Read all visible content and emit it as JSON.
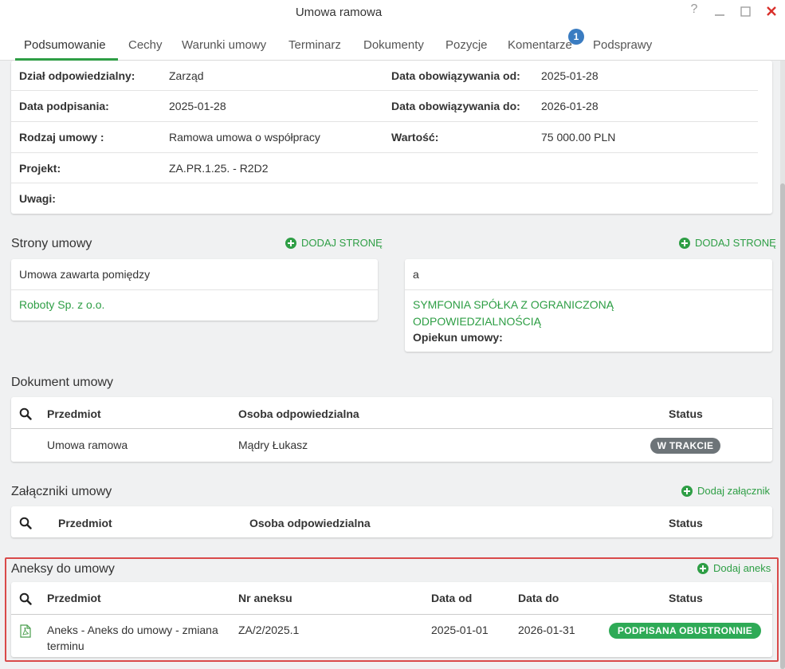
{
  "window": {
    "title": "Umowa ramowa"
  },
  "tabs": [
    {
      "label": "Podsumowanie"
    },
    {
      "label": "Cechy"
    },
    {
      "label": "Warunki umowy"
    },
    {
      "label": "Terminarz"
    },
    {
      "label": "Dokumenty"
    },
    {
      "label": "Pozycje"
    },
    {
      "label": "Komentarze",
      "badge": "1"
    },
    {
      "label": "Podsprawy"
    }
  ],
  "details": {
    "rows": [
      {
        "label": "Dział odpowiedzialny:",
        "value": "Zarząd",
        "label2": "Data obowiązywania od:",
        "value2": "2025-01-28"
      },
      {
        "label": "Data podpisania:",
        "value": "2025-01-28",
        "label2": "Data obowiązywania do:",
        "value2": "2026-01-28"
      },
      {
        "label": "Rodzaj umowy :",
        "value": "Ramowa umowa o współpracy",
        "label2": "Wartość:",
        "value2": "75 000.00 PLN"
      },
      {
        "label": "Projekt:",
        "value": "ZA.PR.1.25. - R2D2"
      },
      {
        "label": "Uwagi:",
        "value": ""
      }
    ]
  },
  "parties": {
    "title": "Strony umowy",
    "add_label": "DODAJ STRONĘ",
    "left": {
      "header": "Umowa zawarta pomiędzy",
      "name": "Roboty Sp. z o.o."
    },
    "right": {
      "header": "a",
      "name_line1": "SYMFONIA SPÓŁKA Z OGRANICZONĄ",
      "name_line2": "ODPOWIEDZIALNOŚCIĄ",
      "guardian_label": "Opiekun umowy:"
    }
  },
  "contract_doc": {
    "title": "Dokument umowy",
    "headers": {
      "subject": "Przedmiot",
      "person": "Osoba odpowiedzialna",
      "status": "Status"
    },
    "rows": [
      {
        "subject": "Umowa ramowa",
        "person": "Mądry Łukasz",
        "status": "W TRAKCIE"
      }
    ]
  },
  "attachments": {
    "title": "Załączniki umowy",
    "add_label": "Dodaj załącznik",
    "headers": {
      "subject": "Przedmiot",
      "person": "Osoba odpowiedzialna",
      "status": "Status"
    }
  },
  "annexes": {
    "title": "Aneksy do umowy",
    "add_label": "Dodaj aneks",
    "headers": {
      "subject": "Przedmiot",
      "number": "Nr aneksu",
      "date_from": "Data od",
      "date_to": "Data do",
      "status": "Status"
    },
    "rows": [
      {
        "subject_line1": "Aneks - Aneks do umowy - zmiana",
        "subject_line2": "terminu",
        "number": "ZA/2/2025.1",
        "date_from": "2025-01-01",
        "date_to": "2026-01-31",
        "status": "PODPISANA OBUSTRONNIE"
      }
    ]
  },
  "colors": {
    "accent": "#2e9e45",
    "badge": "#3a7cc1",
    "status_in_progress": "#6d7478",
    "status_signed": "#2eaa56",
    "highlight": "#d94a4a"
  }
}
